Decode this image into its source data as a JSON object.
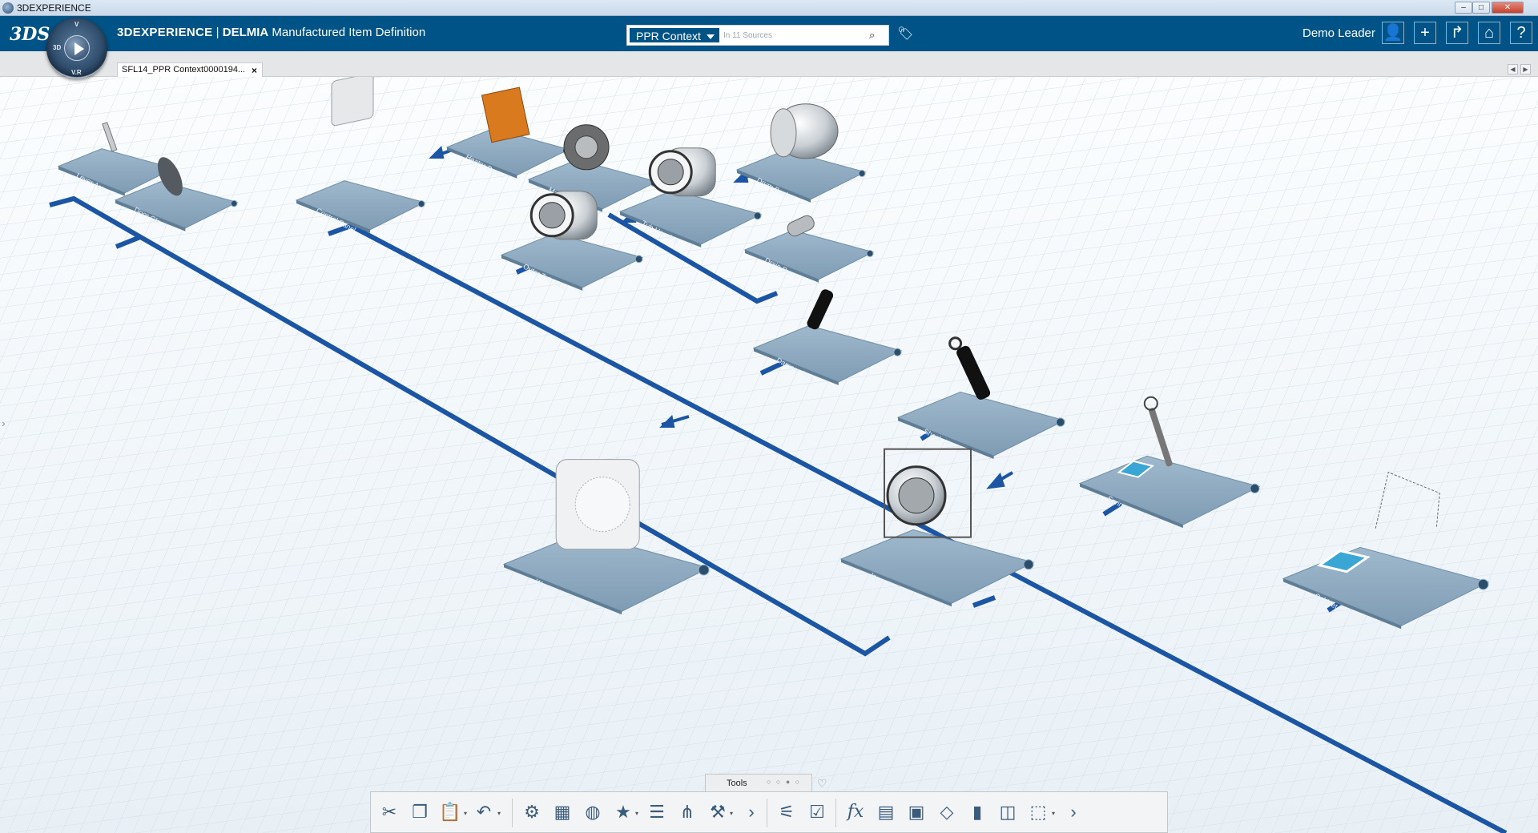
{
  "window": {
    "title": "3DEXPERIENCE"
  },
  "header": {
    "brand_company": "3DEXPERIENCE",
    "brand_separator": "|",
    "brand_product": "DELMIA",
    "brand_app": "Manufactured Item Definition",
    "compass": {
      "top": "3D",
      "left": "3D",
      "bottom": "V.R",
      "label_v": "V"
    },
    "search": {
      "context": "PPR Context",
      "placeholder": "In 11 Sources"
    },
    "user_name": "Demo Leader",
    "icons": [
      "user-icon",
      "add-icon",
      "share-icon",
      "home-icon",
      "help-icon"
    ]
  },
  "tabs": [
    {
      "label": "SFL14_PPR Context0000194...",
      "close": "×"
    }
  ],
  "scene": {
    "accent_blue": "#1a53a0",
    "node_color": "#7f9fb8",
    "nodes": [
      {
        "id": "n1",
        "label": "Lever Arm",
        "object": "lever"
      },
      {
        "id": "n2",
        "label": "Door Glass",
        "object": "glass"
      },
      {
        "id": "n3",
        "label": "Control Panel",
        "object": "panel"
      },
      {
        "id": "n4",
        "label": "Heater Board",
        "object": "board"
      },
      {
        "id": "n5",
        "label": "Motor Assy",
        "object": "motor"
      },
      {
        "id": "n6",
        "label": "Drum Basket",
        "object": "drum"
      },
      {
        "id": "n7",
        "label": "Tub Housing",
        "object": "tub"
      },
      {
        "id": "n8",
        "label": "Outer Tub Assy",
        "object": "tub"
      },
      {
        "id": "n9",
        "label": "Drain Pump",
        "object": "pump"
      },
      {
        "id": "n10",
        "label": "Damper Assy",
        "object": "damper"
      },
      {
        "id": "n11",
        "label": "Shock Absorber 2.1",
        "object": "shock"
      },
      {
        "id": "n12",
        "label": "Washing Machine F-A",
        "object": "washer"
      },
      {
        "id": "n13",
        "label": "Inner Frame F-A Sub",
        "object": "frame"
      },
      {
        "id": "n14",
        "label": "Spring F-A S Sub",
        "object": "spring"
      },
      {
        "id": "n15",
        "label": "Cabinet Frame 60 A.T.",
        "object": "frame-wire"
      }
    ]
  },
  "tools": {
    "tab_label": "Tools",
    "section_dots": "○ ○ ● ○",
    "buttons": [
      "cut-icon",
      "copy-icon",
      "paste-icon",
      "undo-icon",
      "manufacture-icon",
      "assign-icon",
      "globe-icon",
      "favorite-icon",
      "list-icon",
      "structure-icon",
      "settings-icon",
      "more-icon",
      "scope-icon",
      "check-icon",
      "formula-icon",
      "table-icon",
      "properties-icon",
      "shape-icon",
      "bar-icon",
      "split-icon",
      "view-icon",
      "more-icon-2"
    ],
    "formula_label": "fx"
  }
}
